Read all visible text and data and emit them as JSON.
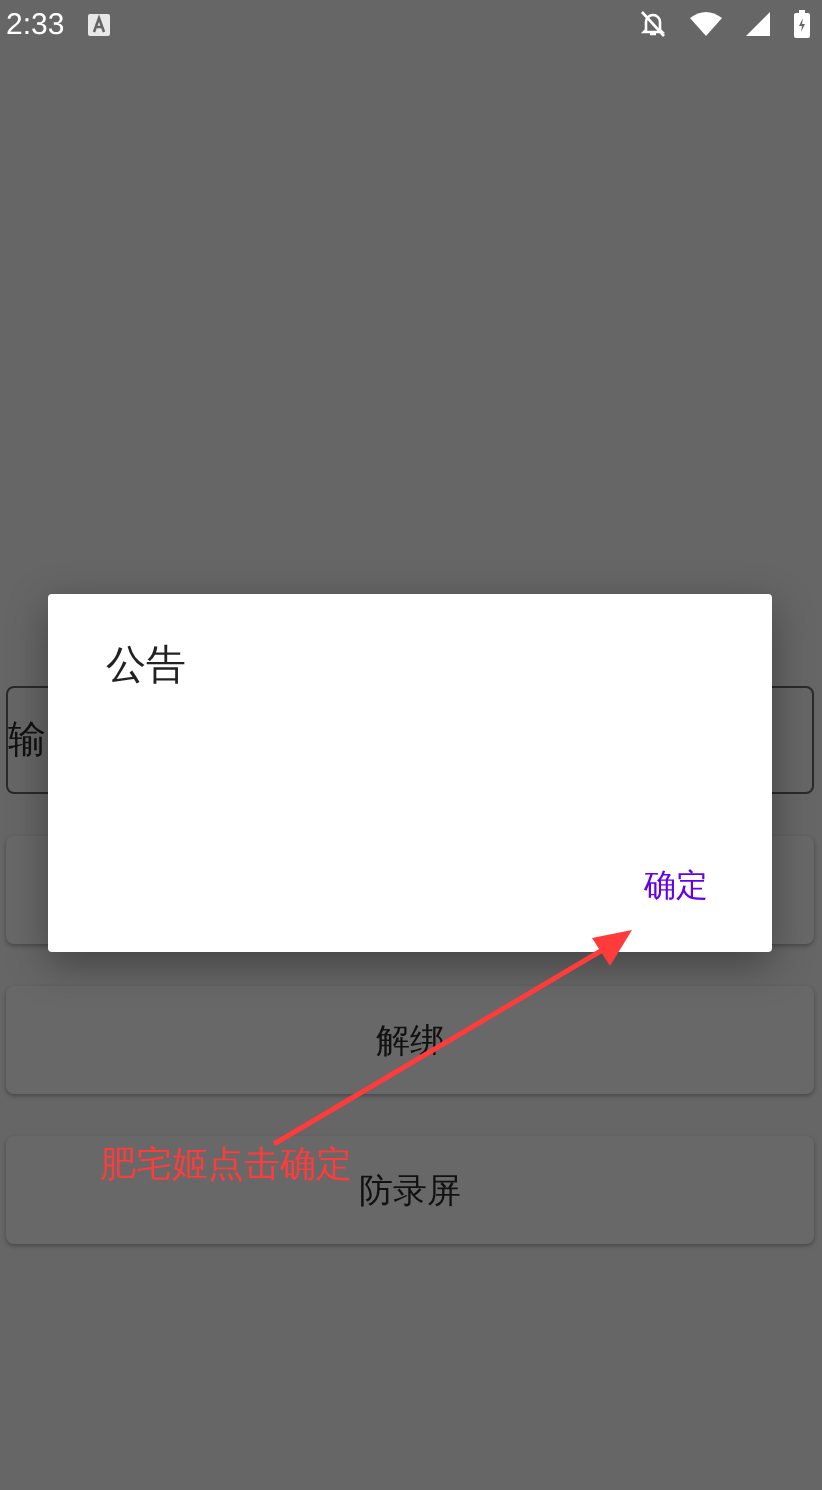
{
  "status_bar": {
    "time": "2:33"
  },
  "form": {
    "input": {
      "value": "输"
    },
    "buttons": [
      {
        "kind": "hidden"
      },
      {
        "kind": "label",
        "label": "解绑"
      },
      {
        "kind": "label",
        "label": "防录屏"
      }
    ]
  },
  "dialog": {
    "title": "公告",
    "confirm": "确定"
  },
  "annotation": {
    "text": "肥宅姬点击确定"
  }
}
